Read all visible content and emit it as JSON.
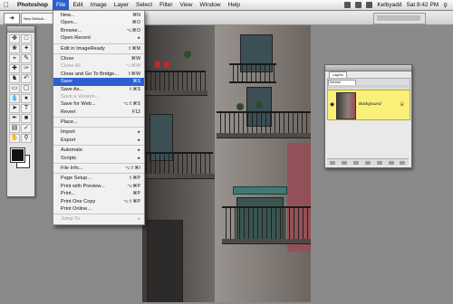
{
  "menubar": {
    "app_name": "Photoshop",
    "menus": [
      "File",
      "Edit",
      "Image",
      "Layer",
      "Select",
      "Filter",
      "View",
      "Window",
      "Help"
    ],
    "active_menu": "File",
    "user": "Kelbyadd",
    "clock": "Sat 8:42 PM"
  },
  "options_bar": {
    "presets_label": "New Default..."
  },
  "file_menu": {
    "items": [
      {
        "label": "New...",
        "shortcut": "⌘N",
        "state": "normal"
      },
      {
        "label": "Open...",
        "shortcut": "⌘O",
        "state": "normal"
      },
      {
        "label": "Browse...",
        "shortcut": "⌥⌘O",
        "state": "normal"
      },
      {
        "label": "Open Recent",
        "shortcut": "▸",
        "state": "normal"
      },
      {
        "sep": true
      },
      {
        "label": "Edit in ImageReady",
        "shortcut": "⇧⌘M",
        "state": "normal"
      },
      {
        "sep": true
      },
      {
        "label": "Close",
        "shortcut": "⌘W",
        "state": "normal"
      },
      {
        "label": "Close All",
        "shortcut": "⌥⌘W",
        "state": "disabled"
      },
      {
        "label": "Close and Go To Bridge...",
        "shortcut": "⇧⌘W",
        "state": "normal"
      },
      {
        "label": "Save",
        "shortcut": "⌘S",
        "state": "active"
      },
      {
        "label": "Save As...",
        "shortcut": "⇧⌘S",
        "state": "normal"
      },
      {
        "label": "Save a Version...",
        "shortcut": "",
        "state": "disabled"
      },
      {
        "label": "Save for Web...",
        "shortcut": "⌥⇧⌘S",
        "state": "normal"
      },
      {
        "label": "Revert",
        "shortcut": "F12",
        "state": "normal"
      },
      {
        "sep": true
      },
      {
        "label": "Place...",
        "shortcut": "",
        "state": "normal"
      },
      {
        "sep": true
      },
      {
        "label": "Import",
        "shortcut": "▸",
        "state": "normal"
      },
      {
        "label": "Export",
        "shortcut": "▸",
        "state": "normal"
      },
      {
        "sep": true
      },
      {
        "label": "Automate",
        "shortcut": "▸",
        "state": "normal"
      },
      {
        "label": "Scripts",
        "shortcut": "▸",
        "state": "normal"
      },
      {
        "sep": true
      },
      {
        "label": "File Info...",
        "shortcut": "⌥⇧⌘I",
        "state": "normal"
      },
      {
        "sep": true
      },
      {
        "label": "Page Setup...",
        "shortcut": "⇧⌘P",
        "state": "normal"
      },
      {
        "label": "Print with Preview...",
        "shortcut": "⌥⌘P",
        "state": "normal"
      },
      {
        "label": "Print...",
        "shortcut": "⌘P",
        "state": "normal"
      },
      {
        "label": "Print One Copy",
        "shortcut": "⌥⇧⌘P",
        "state": "normal"
      },
      {
        "label": "Print Online...",
        "shortcut": "",
        "state": "normal"
      },
      {
        "sep": true
      },
      {
        "label": "Jump To",
        "shortcut": "▸",
        "state": "disabled"
      }
    ]
  },
  "layers_panel": {
    "tab_label": "Layers",
    "blend_mode": "Normal",
    "layer_name": "Background",
    "layer_locked": "🔒"
  },
  "tools": {
    "icons": [
      "move",
      "marquee",
      "lasso",
      "magic-wand",
      "crop",
      "slice",
      "healing",
      "brush",
      "stamp",
      "history-brush",
      "eraser",
      "gradient",
      "blur",
      "dodge",
      "path-select",
      "type",
      "pen",
      "shape",
      "notes",
      "eyedropper",
      "hand",
      "zoom"
    ]
  }
}
